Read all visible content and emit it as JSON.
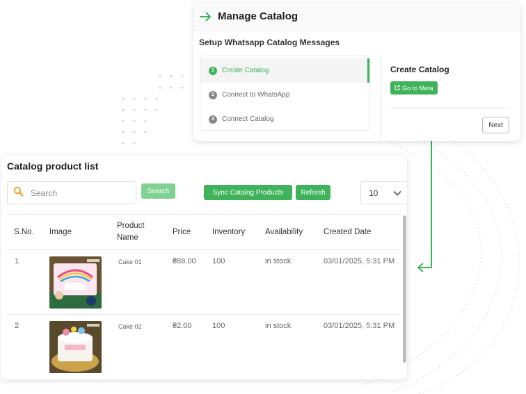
{
  "manage_catalog": {
    "title": "Manage Catalog",
    "subtitle": "Setup Whatsapp Catalog Messages",
    "steps": [
      {
        "num": "1",
        "label": "Create Catalog"
      },
      {
        "num": "2",
        "label": "Connect to WhatsApp"
      },
      {
        "num": "3",
        "label": "Connect Catalog"
      }
    ],
    "panel_title": "Create Catalog",
    "go_to_meta_label": "Go to Meta",
    "next_label": "Next"
  },
  "product_list": {
    "title": "Catalog product list",
    "search_placeholder": "Search",
    "search_button": "Search",
    "sync_button": "Sync Catalog Products",
    "refresh_button": "Refresh",
    "page_size": "10",
    "columns": {
      "sno": "S.No.",
      "image": "Image",
      "product_name_1": "Product",
      "product_name_2": "Name",
      "price": "Price",
      "inventory": "Inventory",
      "availability": "Availability",
      "created_date": "Created Date"
    },
    "rows": [
      {
        "sno": "1",
        "name": "Cake 01",
        "price": "₴88.00",
        "inventory": "100",
        "availability": "in stock",
        "created": "03/01/2025, 5:31 PM"
      },
      {
        "sno": "2",
        "name": "Cake 02",
        "price": "₴2.00",
        "inventory": "100",
        "availability": "in stock",
        "created": "03/01/2025, 5:31 PM"
      }
    ]
  },
  "colors": {
    "accent": "#3fb35a",
    "accent_light": "#7fd291"
  }
}
